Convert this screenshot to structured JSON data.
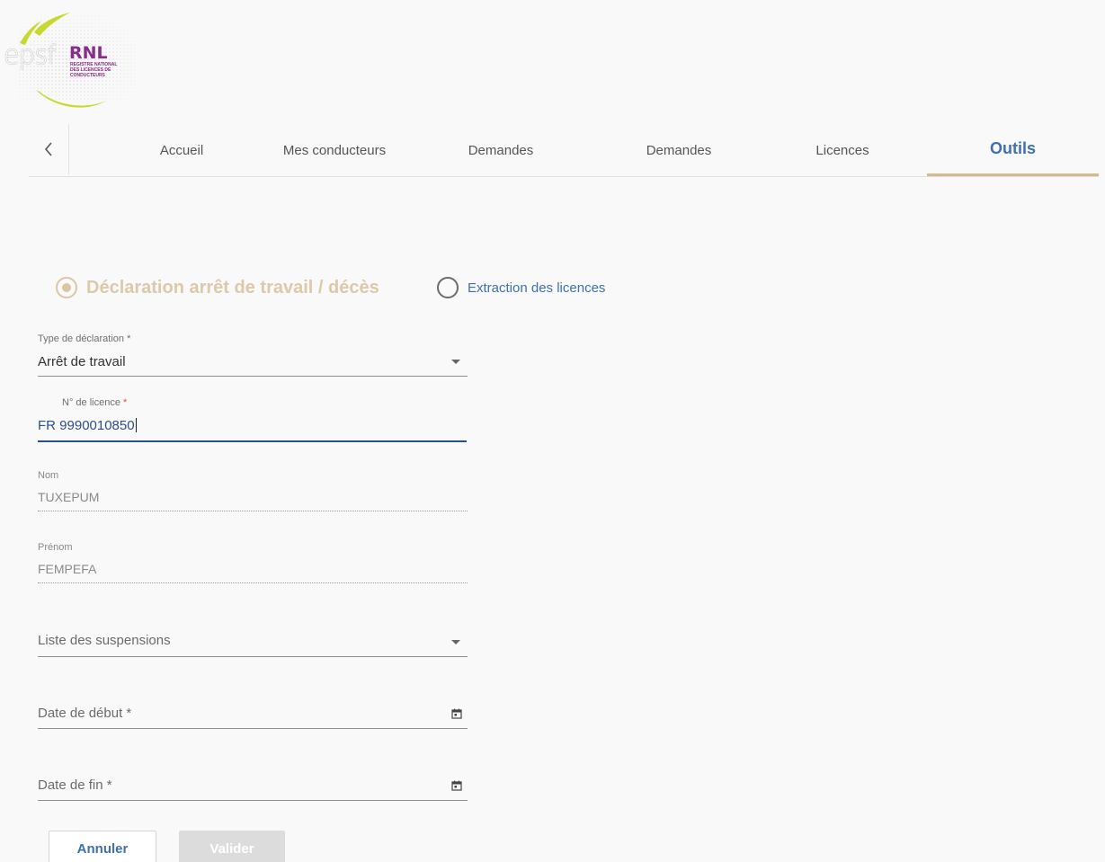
{
  "logo": {
    "epsf_text": "epsf",
    "rnl_text": "RNL",
    "rnl_subtitle_lines": [
      "REGISTRE NATIONAL",
      "DES LICENCES DE",
      "CONDUCTEURS"
    ]
  },
  "nav": {
    "back_icon": "chevron-left-icon",
    "tabs": [
      {
        "label": "Accueil",
        "active": false
      },
      {
        "label": "Mes conducteurs",
        "active": false
      },
      {
        "label": "Demandes",
        "active": false
      },
      {
        "label": "Demandes",
        "active": false
      },
      {
        "label": "Licences",
        "active": false
      },
      {
        "label": "Outils",
        "active": true
      }
    ]
  },
  "mode": {
    "options": [
      {
        "label": "Déclaration arrêt de travail / décès",
        "checked": true
      },
      {
        "label": "Extraction des licences",
        "checked": false
      }
    ]
  },
  "form": {
    "type_declaration": {
      "label": "Type de déclaration *",
      "value": "Arrêt de travail"
    },
    "licence": {
      "label": "N° de licence",
      "required_mark": "*",
      "value": "FR 9990010850"
    },
    "nom": {
      "label": "Nom",
      "value": "TUXEPUM"
    },
    "prenom": {
      "label": "Prénom",
      "value": "FEMPEFA"
    },
    "suspensions": {
      "placeholder": "Liste des suspensions"
    },
    "date_debut": {
      "placeholder": "Date de début *"
    },
    "date_fin": {
      "placeholder": "Date de fin *"
    }
  },
  "actions": {
    "cancel_label": "Annuler",
    "validate_label": "Valider"
  },
  "colors": {
    "accent_blue": "#3f6fb4",
    "accent_gold": "#d8b98a",
    "logo_green": "#c7d92f",
    "logo_purple": "#8a2c8c"
  }
}
